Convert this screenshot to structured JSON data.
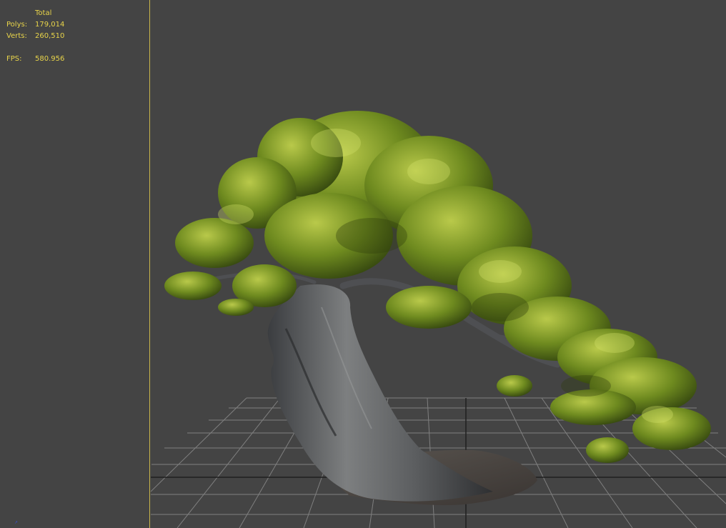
{
  "stats": {
    "header": "Total",
    "polys_label": "Polys:",
    "polys_value": "179,014",
    "verts_label": "Verts:",
    "verts_value": "260,510",
    "fps_label": "FPS:",
    "fps_value": "580.956"
  },
  "colors": {
    "viewport_bg": "#444444",
    "stats_text": "#e8d44a",
    "divider": "#c9b64a",
    "grid": "#8a8a8a",
    "grid_axis": "#1f1f1f"
  },
  "icons": {
    "axis": "axis-tripod-icon"
  }
}
